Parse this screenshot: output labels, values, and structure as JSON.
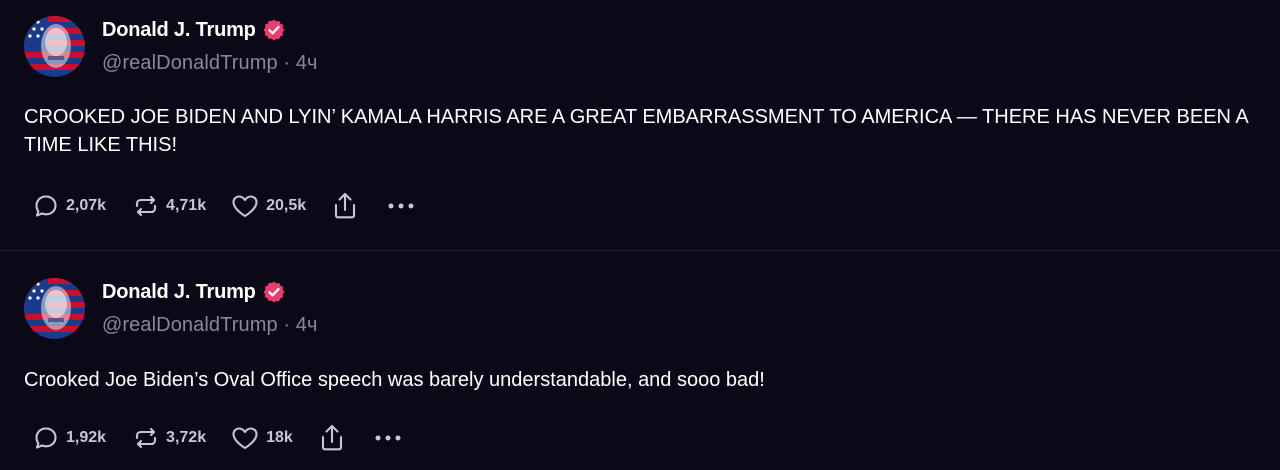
{
  "posts": [
    {
      "author": {
        "name": "Donald J. Trump",
        "handle": "@realDonaldTrump",
        "time": "4ч"
      },
      "text": "CROOKED JOE BIDEN AND LYIN’ KAMALA HARRIS ARE A GREAT EMBARRASSMENT TO AMERICA — THERE HAS NEVER BEEN A TIME LIKE THIS!",
      "stats": {
        "replies": "2,07k",
        "reposts": "4,71k",
        "likes": "20,5k"
      }
    },
    {
      "author": {
        "name": "Donald J. Trump",
        "handle": "@realDonaldTrump",
        "time": "4ч"
      },
      "text": "Crooked Joe Biden’s Oval Office speech was barely understandable, and sooo bad!",
      "stats": {
        "replies": "1,92k",
        "reposts": "3,72k",
        "likes": "18k"
      }
    }
  ],
  "icons": {
    "reply": "reply-icon",
    "repost": "repost-icon",
    "like": "heart-icon",
    "share": "share-icon",
    "more": "more-icon",
    "verified": "verified-badge-icon"
  },
  "colors": {
    "background": "#0b0818",
    "verified": "#e83d6f",
    "muted_text": "#8a8797"
  }
}
